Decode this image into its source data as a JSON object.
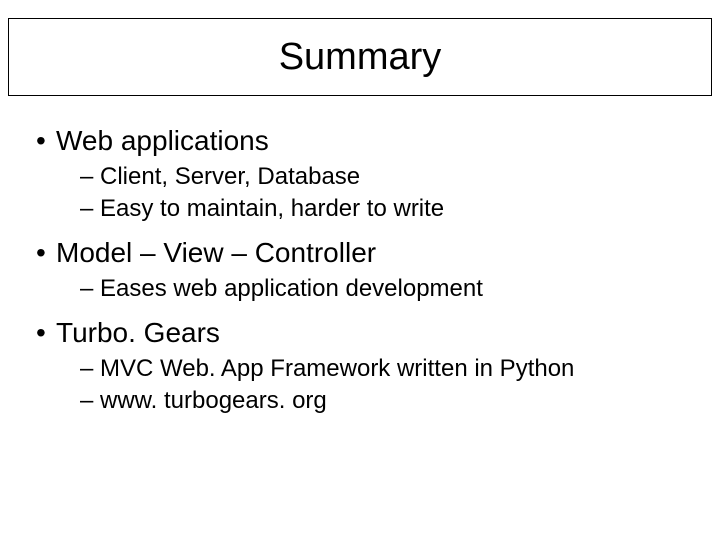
{
  "title": "Summary",
  "bullets": [
    {
      "text": "Web applications",
      "subs": [
        "Client, Server, Database",
        "Easy to maintain, harder to write"
      ]
    },
    {
      "text": "Model – View – Controller",
      "subs": [
        "Eases web application development"
      ]
    },
    {
      "text": "Turbo. Gears",
      "subs": [
        "MVC Web. App Framework written in Python",
        "www. turbogears. org"
      ]
    }
  ]
}
